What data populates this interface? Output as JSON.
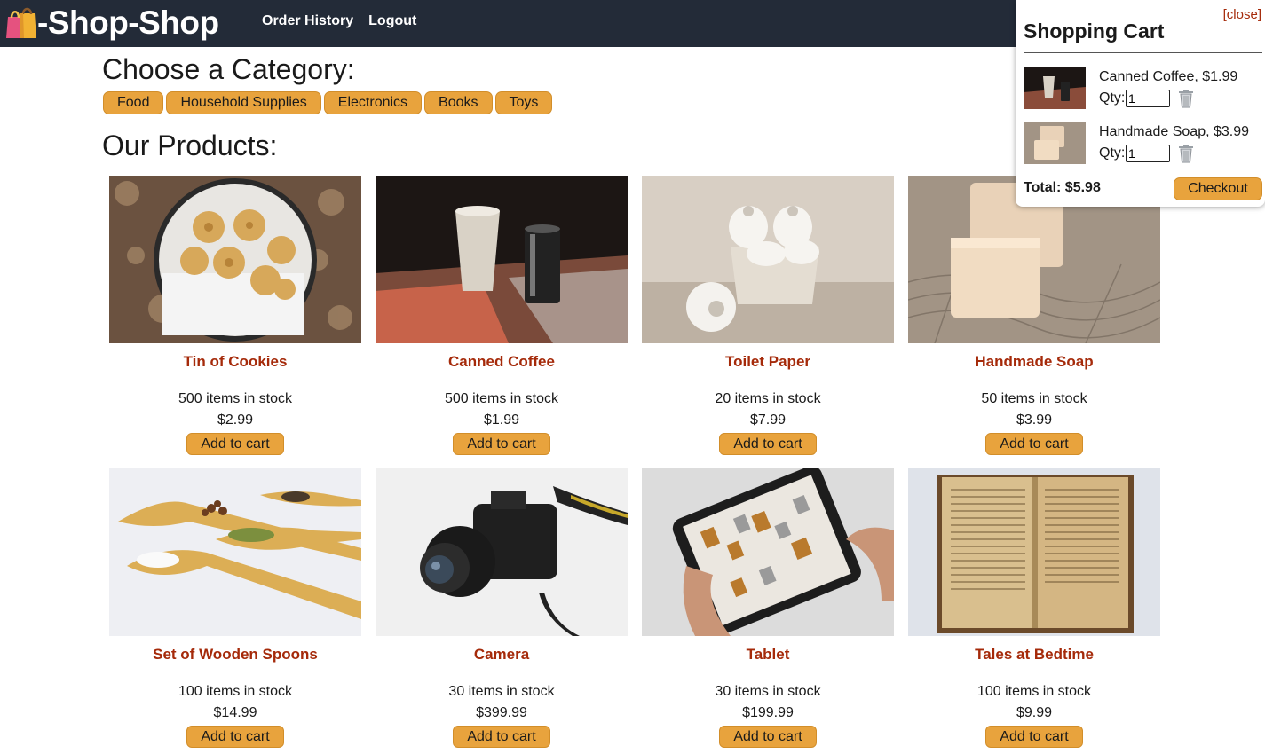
{
  "app": {
    "brand": "-Shop-Shop",
    "nav": [
      "Order History",
      "Logout"
    ]
  },
  "categories": {
    "title": "Choose a Category:",
    "items": [
      "Food",
      "Household Supplies",
      "Electronics",
      "Books",
      "Toys"
    ]
  },
  "products": {
    "title": "Our Products:",
    "items": [
      {
        "name": "Tin of Cookies",
        "stock": "500 items in stock",
        "price": "$2.99",
        "button": "Add to cart"
      },
      {
        "name": "Canned Coffee",
        "stock": "500 items in stock",
        "price": "$1.99",
        "button": "Add to cart"
      },
      {
        "name": "Toilet Paper",
        "stock": "20 items in stock",
        "price": "$7.99",
        "button": "Add to cart"
      },
      {
        "name": "Handmade Soap",
        "stock": "50 items in stock",
        "price": "$3.99",
        "button": "Add to cart"
      },
      {
        "name": "Set of Wooden Spoons",
        "stock": "100 items in stock",
        "price": "$14.99",
        "button": "Add to cart"
      },
      {
        "name": "Camera",
        "stock": "30 items in stock",
        "price": "$399.99",
        "button": "Add to cart"
      },
      {
        "name": "Tablet",
        "stock": "30 items in stock",
        "price": "$199.99",
        "button": "Add to cart"
      },
      {
        "name": "Tales at Bedtime",
        "stock": "100 items in stock",
        "price": "$9.99",
        "button": "Add to cart"
      }
    ]
  },
  "cart": {
    "close_label": "[close]",
    "title": "Shopping Cart",
    "items": [
      {
        "label": "Canned Coffee, $1.99",
        "qty_label": "Qty:",
        "qty": "1"
      },
      {
        "label": "Handmade Soap, $3.99",
        "qty_label": "Qty:",
        "qty": "1"
      }
    ],
    "total": "Total: $5.98",
    "checkout_label": "Checkout"
  },
  "colors": {
    "navbar": "#232b38",
    "accent_button": "#e8a33d",
    "product_name": "#a52a0a"
  }
}
